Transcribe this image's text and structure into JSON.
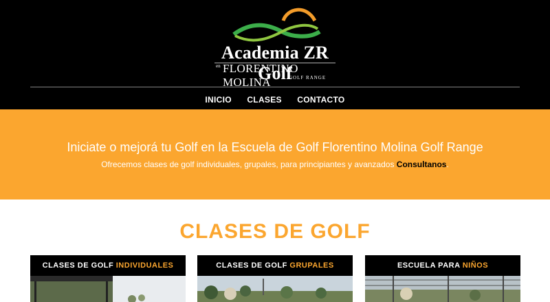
{
  "logo": {
    "title": "Academia ZR Golf",
    "en": "en",
    "subtitle": "FLORENTINO MOLINA",
    "range": "GOLF RANGE"
  },
  "nav": [
    {
      "label": "INICIO"
    },
    {
      "label": "CLASES"
    },
    {
      "label": "CONTACTO"
    }
  ],
  "hero": {
    "title": "Iniciate o mejorá tu Golf en la Escuela de Golf Florentino Molina Golf Range",
    "subtitle": "Ofrecemos clases de golf individuales, grupales, para principiantes y avanzados",
    "link": "Consultanos",
    "period": "."
  },
  "section": {
    "title": "CLASES DE GOLF"
  },
  "cards": [
    {
      "prefix": "CLASES DE GOLF ",
      "accent": "INDIVIDUALES"
    },
    {
      "prefix": "CLASES DE GOLF ",
      "accent": "GRUPALES"
    },
    {
      "prefix": "ESCUELA PARA ",
      "accent": "NIÑOS"
    }
  ],
  "colors": {
    "accent": "#fba62f",
    "header": "#000000",
    "logo_green": "#3cae4a"
  }
}
